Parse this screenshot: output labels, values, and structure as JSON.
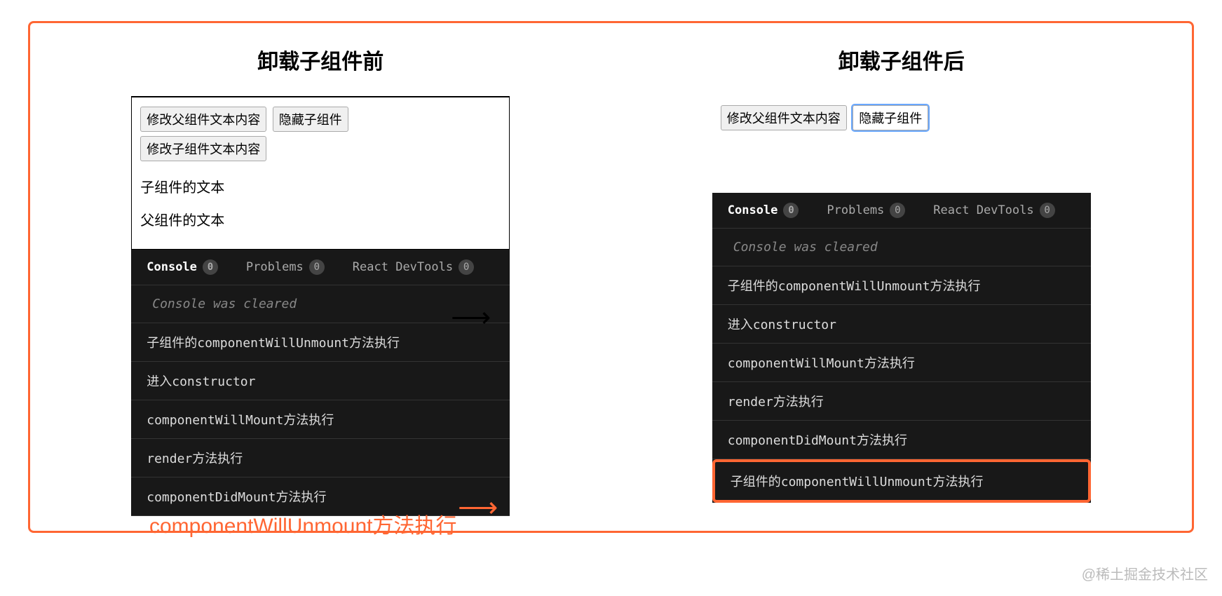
{
  "left": {
    "title": "卸载子组件前",
    "buttons": {
      "modify_parent": "修改父组件文本内容",
      "hide_child": "隐藏子组件",
      "modify_child": "修改子组件文本内容"
    },
    "texts": {
      "child": "子组件的文本",
      "parent": "父组件的文本"
    },
    "tabs": {
      "console": "Console",
      "problems": "Problems",
      "react": "React DevTools",
      "count": "0"
    },
    "cleared": "Console was cleared",
    "logs": [
      "子组件的componentWillUnmount方法执行",
      "进入constructor",
      "componentWillMount方法执行",
      "render方法执行",
      "componentDidMount方法执行"
    ]
  },
  "right": {
    "title": "卸载子组件后",
    "buttons": {
      "modify_parent": "修改父组件文本内容",
      "hide_child": "隐藏子组件"
    },
    "tabs": {
      "console": "Console",
      "problems": "Problems",
      "react": "React DevTools",
      "count": "0"
    },
    "cleared": "Console was cleared",
    "logs": [
      "子组件的componentWillUnmount方法执行",
      "进入constructor",
      "componentWillMount方法执行",
      "render方法执行",
      "componentDidMount方法执行",
      "子组件的componentWillUnmount方法执行"
    ]
  },
  "caption": "componentWillUnmount方法执行",
  "watermark": "@稀土掘金技术社区"
}
